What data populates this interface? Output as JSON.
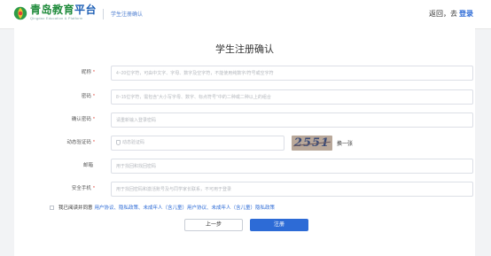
{
  "header": {
    "logo_title_green": "青岛教育",
    "logo_title_blue": "平台",
    "logo_subtitle": "Qingdao Education & Platform",
    "breadcrumb": "学生注册确认",
    "back_text": "返回，去",
    "login_text": "登录"
  },
  "form": {
    "title": "学生注册确认",
    "fields": [
      {
        "label": "昵称",
        "required": "*",
        "placeholder": "4~20位字符，可由中文字、字母、数字及空字符，不能使用纯数字/符号或空字符"
      },
      {
        "label": "密码",
        "required": "*",
        "placeholder": "8~15位字符，需包含\"大小写字母、数字、标点符号\"中的二种或二种以上的组合"
      },
      {
        "label": "确认密码",
        "required": "*",
        "placeholder": "请重新输入登录密码"
      },
      {
        "label": "动态验证码",
        "required": "*",
        "placeholder": "动态验证码"
      },
      {
        "label": "邮箱",
        "required": "",
        "placeholder": "用于找回和找回密码"
      },
      {
        "label": "安全手机",
        "required": "*",
        "placeholder": "用于找回密码和激活账号及与同学家长联系，不可用于登录"
      }
    ],
    "captcha_text": "2551",
    "refresh_label": "换一张",
    "agree_prefix": "我已阅读并同意",
    "agree_links": "用户协议、隐私政策、未成年人（含儿童）用户协议、未成年人（含儿童）隐私政策",
    "prev_button": "上一步",
    "register_button": "注册"
  },
  "colors": {
    "accent": "#2d6bd6",
    "brand_green": "#1f8b3b",
    "required": "#e0433a"
  }
}
